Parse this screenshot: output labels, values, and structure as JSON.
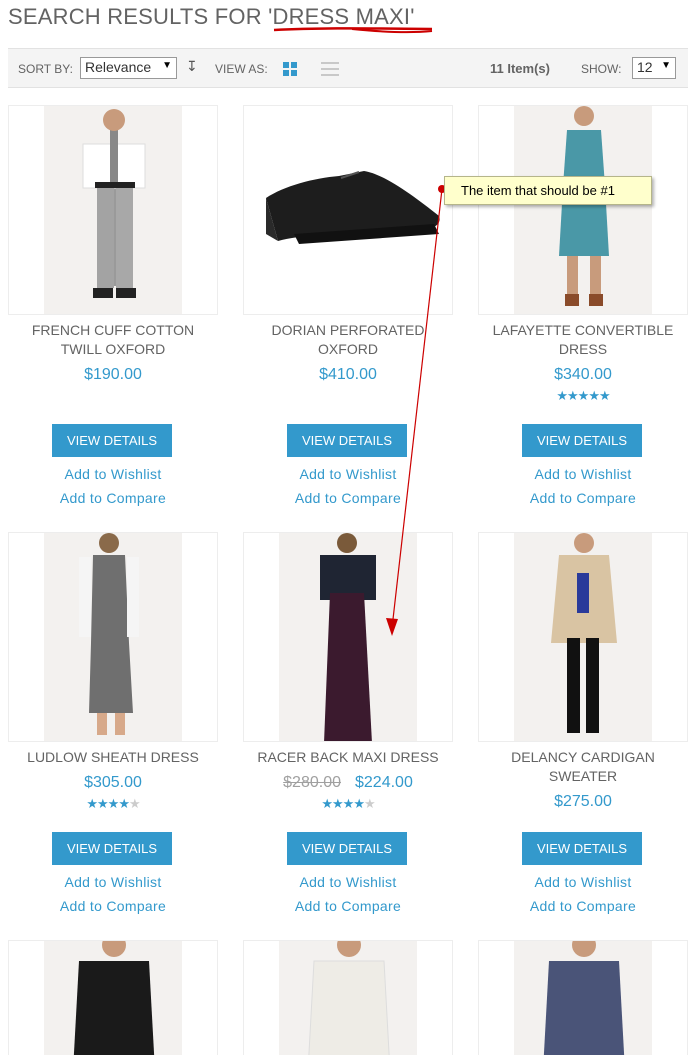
{
  "page": {
    "title_prefix": "SEARCH RESULTS FOR '",
    "query": "DRESS MAXI",
    "title_suffix": "'"
  },
  "toolbar": {
    "sort_label": "SORT BY:",
    "sort_value": "Relevance",
    "view_label": "VIEW AS:",
    "item_count": "11 Item(s)",
    "show_label": "SHOW:",
    "show_value": "12"
  },
  "annotation": {
    "text": "The item that should be #1",
    "color": "#cc0000"
  },
  "colors": {
    "accent": "#3399cc",
    "annotation_red": "#cc0000"
  },
  "products": [
    {
      "name": "FRENCH CUFF COTTON TWILL OXFORD",
      "price": "$190.00",
      "button": "VIEW DETAILS",
      "wishlist": "Add to Wishlist",
      "compare": "Add to Compare"
    },
    {
      "name": "DORIAN PERFORATED OXFORD",
      "price": "$410.00",
      "button": "VIEW DETAILS",
      "wishlist": "Add to Wishlist",
      "compare": "Add to Compare"
    },
    {
      "name": "LAFAYETTE CONVERTIBLE DRESS",
      "price": "$340.00",
      "rating": 5,
      "button": "VIEW DETAILS",
      "wishlist": "Add to Wishlist",
      "compare": "Add to Compare"
    },
    {
      "name": "LUDLOW SHEATH DRESS",
      "price": "$305.00",
      "rating": 4.5,
      "button": "VIEW DETAILS",
      "wishlist": "Add to Wishlist",
      "compare": "Add to Compare"
    },
    {
      "name": "RACER BACK MAXI DRESS",
      "old_price": "$280.00",
      "price": "$224.00",
      "rating": 4,
      "button": "VIEW DETAILS",
      "wishlist": "Add to Wishlist",
      "compare": "Add to Compare"
    },
    {
      "name": "DELANCY CARDIGAN SWEATER",
      "price": "$275.00",
      "button": "VIEW DETAILS",
      "wishlist": "Add to Wishlist",
      "compare": "Add to Compare"
    }
  ]
}
